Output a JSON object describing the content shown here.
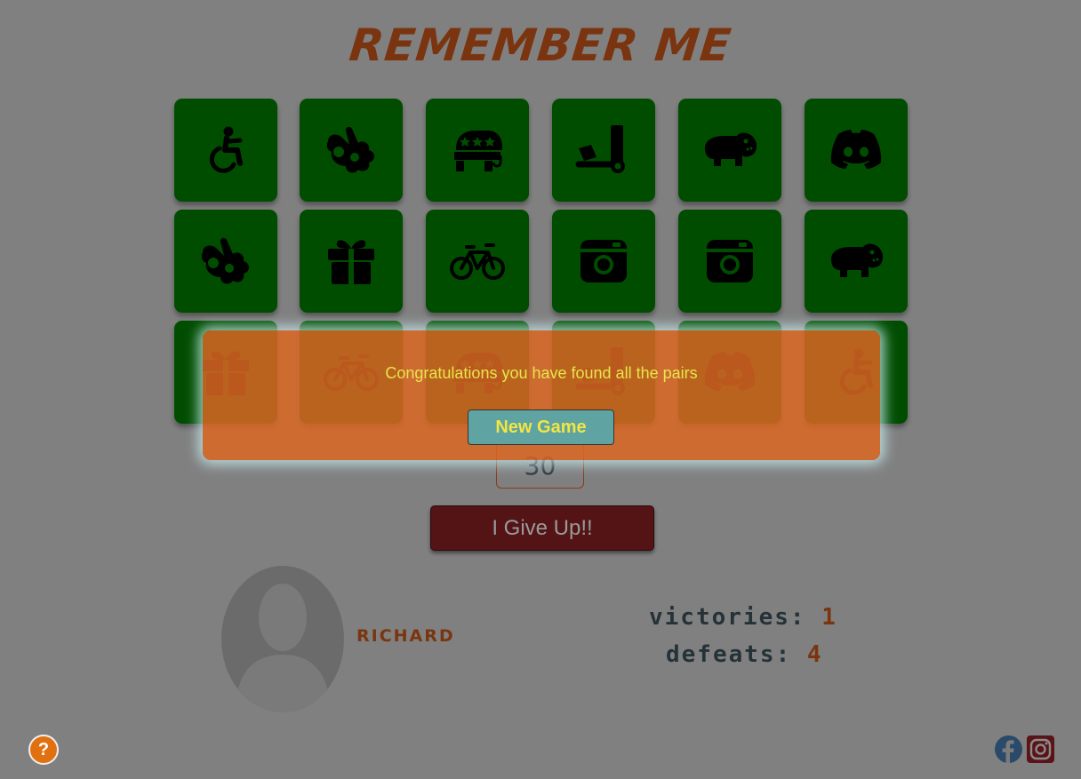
{
  "header": {
    "title": "REMEMBER ME"
  },
  "board": {
    "cards": [
      {
        "icon": "wheelchair-icon"
      },
      {
        "icon": "sign-language-icon"
      },
      {
        "icon": "republican-elephant-icon"
      },
      {
        "icon": "dolly-icon"
      },
      {
        "icon": "hippo-icon"
      },
      {
        "icon": "discord-icon"
      },
      {
        "icon": "sign-language-icon"
      },
      {
        "icon": "gift-icon"
      },
      {
        "icon": "bicycle-icon"
      },
      {
        "icon": "camera-icon"
      },
      {
        "icon": "camera-icon"
      },
      {
        "icon": "hippo-icon"
      },
      {
        "icon": "gift-icon"
      },
      {
        "icon": "bicycle-icon"
      },
      {
        "icon": "republican-elephant-icon"
      },
      {
        "icon": "dolly-icon"
      },
      {
        "icon": "discord-icon"
      },
      {
        "icon": "wheelchair-icon"
      }
    ]
  },
  "counter": {
    "value": "30"
  },
  "controls": {
    "give_up_label": "I Give Up!!"
  },
  "player": {
    "name": "RICHARD"
  },
  "stats": {
    "victories_label": "victories:",
    "victories": "1",
    "defeats_label": "defeats:",
    "defeats": "4"
  },
  "help": {
    "label": "?"
  },
  "modal": {
    "message": "Congratulations you have found all the pairs",
    "new_game_label": "New Game"
  },
  "colors": {
    "card": "#004d00",
    "title": "#7a3510",
    "overlay": "#da6723",
    "new_game_bg": "#5fa3a3",
    "give_up_bg": "#541416"
  }
}
